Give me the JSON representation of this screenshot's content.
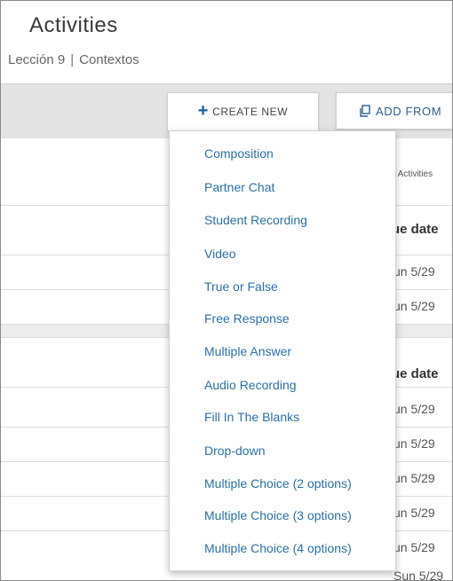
{
  "header": {
    "title": "Activities",
    "breadcrumb": {
      "lesson": "Lección 9",
      "section": "Contextos",
      "separator": "|"
    }
  },
  "toolbar": {
    "create_new_label": "CREATE NEW",
    "add_from_label": "ADD FROM"
  },
  "filter": {
    "text": "ll Activities"
  },
  "sections": [
    {
      "due_header": "ue date",
      "rows": [
        "un 5/29",
        "un 5/29"
      ]
    },
    {
      "due_header": "ue date",
      "rows": [
        "un 5/29",
        "un 5/29",
        "un 5/29",
        "un 5/29",
        "un 5/29",
        "Sun 5/29"
      ]
    }
  ],
  "create_menu": {
    "items": [
      "Composition",
      "Partner Chat",
      "Student Recording",
      "Video",
      "True or False",
      "Free Response",
      "Multiple Answer",
      "Audio Recording",
      "Fill In The Blanks",
      "Drop-down",
      "Multiple Choice (2 options)",
      "Multiple Choice (3 options)",
      "Multiple Choice (4 options)"
    ]
  },
  "colors": {
    "link": "#2b6fa8",
    "toolbar_bg": "#e3e3e3",
    "accent": "#1e5b93"
  }
}
